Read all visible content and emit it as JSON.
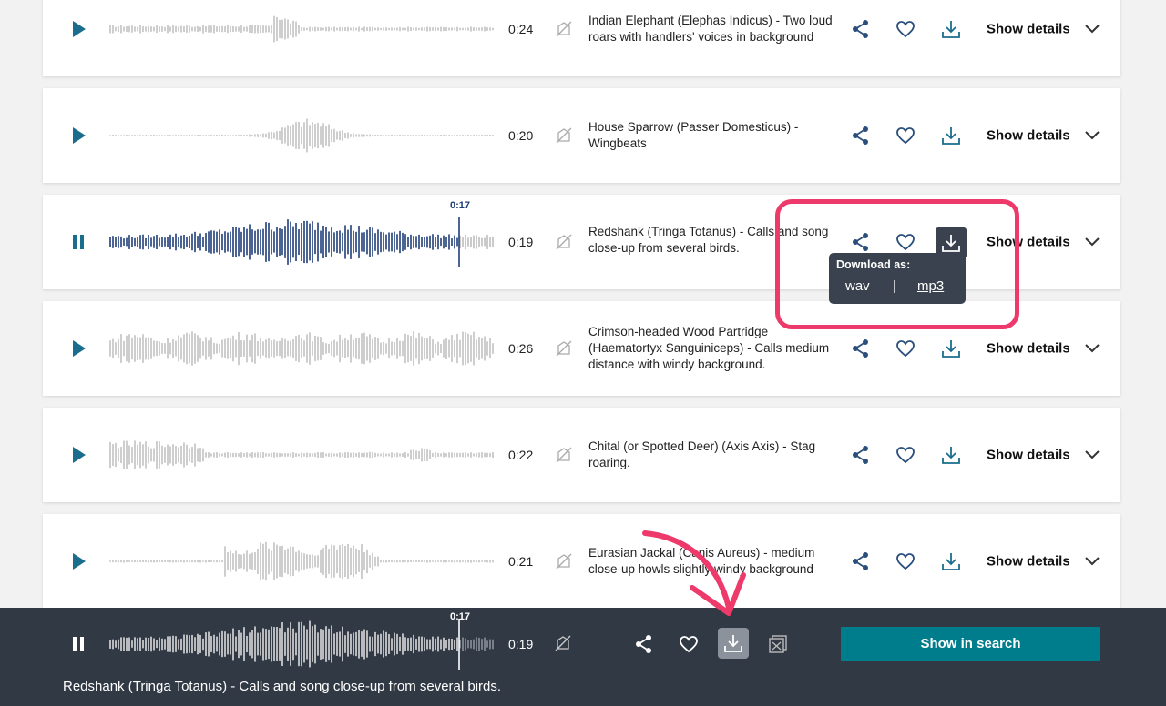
{
  "colors": {
    "accent": "#007d8c",
    "active_wave": "#203e78",
    "inactive_wave": "#c2c2c2",
    "icon_blue": "#2a4f7c",
    "highlight": "#ee3a6a",
    "player_bg": "#313945"
  },
  "results": [
    {
      "title": "Indian Elephant (Elephas Indicus) - Two loud roars with handlers' voices in background",
      "duration": "0:24",
      "details_label": "Show details",
      "state": "play"
    },
    {
      "title": "House Sparrow (Passer Domesticus) - Wingbeats",
      "duration": "0:20",
      "details_label": "Show details",
      "state": "play"
    },
    {
      "title": "Redshank (Tringa Totanus) - Calls and song close-up from several birds.",
      "duration": "0:19",
      "details_label": "Show details",
      "state": "playing",
      "playhead": "0:17"
    },
    {
      "title": "Crimson-headed Wood Partridge (Haematortyx Sanguiniceps) - Calls medium distance with windy background.",
      "duration": "0:26",
      "details_label": "Show details",
      "state": "play"
    },
    {
      "title": "Chital (or Spotted Deer) (Axis Axis) - Stag roaring.",
      "duration": "0:22",
      "details_label": "Show details",
      "state": "play"
    },
    {
      "title": "Eurasian Jackal (Canis Aureus) - medium close-up howls slightly windy background",
      "duration": "0:21",
      "details_label": "Show details",
      "state": "play"
    }
  ],
  "download_popup": {
    "title": "Download as:",
    "wav": "wav",
    "separator": "|",
    "mp3": "mp3"
  },
  "player": {
    "current_time": "0:17",
    "duration": "0:19",
    "search_button": "Show in search",
    "now_playing": "Redshank (Tringa Totanus) - Calls and song close-up from several birds."
  },
  "icons": {
    "play": "play-icon",
    "pause": "pause-icon",
    "no_license": "no-license-icon",
    "share": "share-icon",
    "favourite": "heart-icon",
    "download": "download-icon",
    "details": "chevron-down-icon",
    "close_player": "close-player-icon"
  }
}
